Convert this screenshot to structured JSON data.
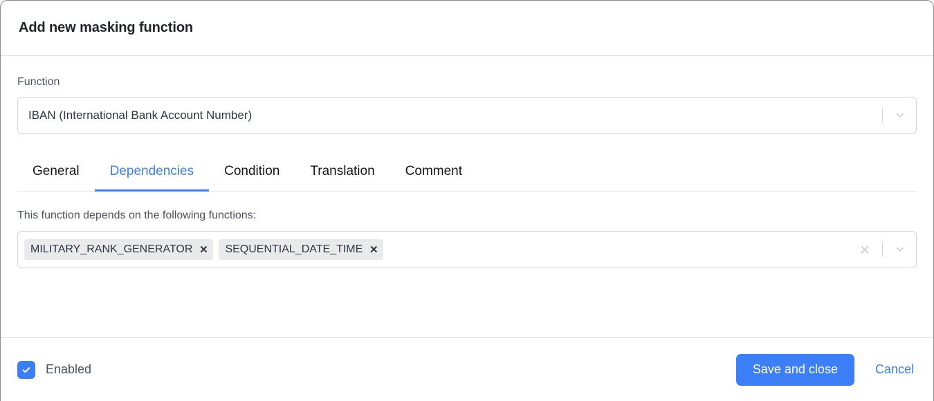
{
  "dialog": {
    "title": "Add new masking function"
  },
  "function_field": {
    "label": "Function",
    "selected_value": "IBAN (International Bank Account Number)",
    "dropdown_icon": "chevron-down-icon"
  },
  "tabs": [
    {
      "label": "General",
      "active": false
    },
    {
      "label": "Dependencies",
      "active": true
    },
    {
      "label": "Condition",
      "active": false
    },
    {
      "label": "Translation",
      "active": false
    },
    {
      "label": "Comment",
      "active": false
    }
  ],
  "dependencies": {
    "description": "This function depends on the following functions:",
    "chips": [
      {
        "label": "MILITARY_RANK_GENERATOR",
        "remove": "✕"
      },
      {
        "label": "SEQUENTIAL_DATE_TIME",
        "remove": "✕"
      }
    ],
    "clear_icon": "clear-icon",
    "dropdown_icon": "chevron-down-icon"
  },
  "footer": {
    "enabled_label": "Enabled",
    "enabled_checked": true,
    "save_label": "Save and close",
    "cancel_label": "Cancel"
  },
  "colors": {
    "accent": "#3b7ef5",
    "text": "#2f3640",
    "muted": "#4a5360",
    "border": "#cfd4da",
    "chip_bg": "#e8eaec"
  }
}
